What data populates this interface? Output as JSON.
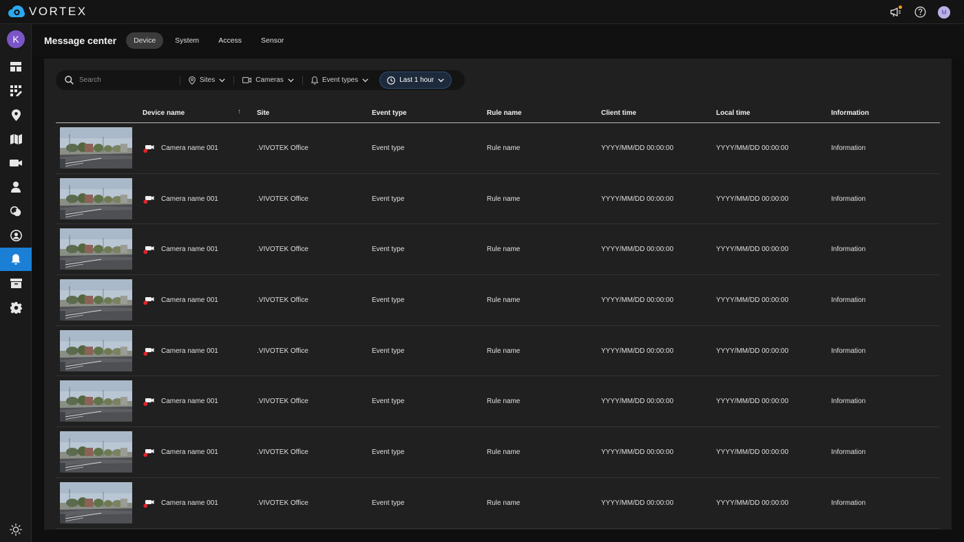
{
  "app": {
    "brand": "VORTEX",
    "user_initial": "M",
    "accent": "#1c7fd6"
  },
  "sidebar": {
    "org_initial": "K",
    "items": [
      {
        "icon": "dashboard-icon"
      },
      {
        "icon": "apps-edit-icon"
      },
      {
        "icon": "location-pin-icon"
      },
      {
        "icon": "map-icon"
      },
      {
        "icon": "camera-icon"
      },
      {
        "icon": "person-icon"
      },
      {
        "icon": "analytics-icon"
      },
      {
        "icon": "user-circle-icon"
      },
      {
        "icon": "bell-icon",
        "active": true
      },
      {
        "icon": "archive-icon"
      },
      {
        "icon": "gear-icon"
      }
    ],
    "bottom_icon": "sun-icon"
  },
  "header": {
    "title": "Message center",
    "tabs": [
      {
        "label": "Device",
        "active": true
      },
      {
        "label": "System"
      },
      {
        "label": "Access"
      },
      {
        "label": "Sensor"
      }
    ]
  },
  "filters": {
    "search_placeholder": "Search",
    "sites": "Sites",
    "cameras": "Cameras",
    "event_types": "Event types",
    "time": "Last 1 hour"
  },
  "table": {
    "columns": [
      "Device name",
      "Site",
      "Event type",
      "Rule name",
      "Client time",
      "Local time",
      "Information"
    ],
    "sort_indicator": "↑",
    "rows": [
      {
        "device": "Camera name 001",
        "site": ".VIVOTEK Office",
        "event": "Event type",
        "rule": "Rule name",
        "client_time": "YYYY/MM/DD 00:00:00",
        "local_time": "YYYY/MM/DD 00:00:00",
        "info": "Information"
      },
      {
        "device": "Camera name 001",
        "site": ".VIVOTEK Office",
        "event": "Event type",
        "rule": "Rule name",
        "client_time": "YYYY/MM/DD 00:00:00",
        "local_time": "YYYY/MM/DD 00:00:00",
        "info": "Information"
      },
      {
        "device": "Camera name 001",
        "site": ".VIVOTEK Office",
        "event": "Event type",
        "rule": "Rule name",
        "client_time": "YYYY/MM/DD 00:00:00",
        "local_time": "YYYY/MM/DD 00:00:00",
        "info": "Information"
      },
      {
        "device": "Camera name 001",
        "site": ".VIVOTEK Office",
        "event": "Event type",
        "rule": "Rule name",
        "client_time": "YYYY/MM/DD 00:00:00",
        "local_time": "YYYY/MM/DD 00:00:00",
        "info": "Information"
      },
      {
        "device": "Camera name 001",
        "site": ".VIVOTEK Office",
        "event": "Event type",
        "rule": "Rule name",
        "client_time": "YYYY/MM/DD 00:00:00",
        "local_time": "YYYY/MM/DD 00:00:00",
        "info": "Information"
      },
      {
        "device": "Camera name 001",
        "site": ".VIVOTEK Office",
        "event": "Event type",
        "rule": "Rule name",
        "client_time": "YYYY/MM/DD 00:00:00",
        "local_time": "YYYY/MM/DD 00:00:00",
        "info": "Information"
      },
      {
        "device": "Camera name 001",
        "site": ".VIVOTEK Office",
        "event": "Event type",
        "rule": "Rule name",
        "client_time": "YYYY/MM/DD 00:00:00",
        "local_time": "YYYY/MM/DD 00:00:00",
        "info": "Information"
      },
      {
        "device": "Camera name 001",
        "site": ".VIVOTEK Office",
        "event": "Event type",
        "rule": "Rule name",
        "client_time": "YYYY/MM/DD 00:00:00",
        "local_time": "YYYY/MM/DD 00:00:00",
        "info": "Information"
      }
    ]
  }
}
